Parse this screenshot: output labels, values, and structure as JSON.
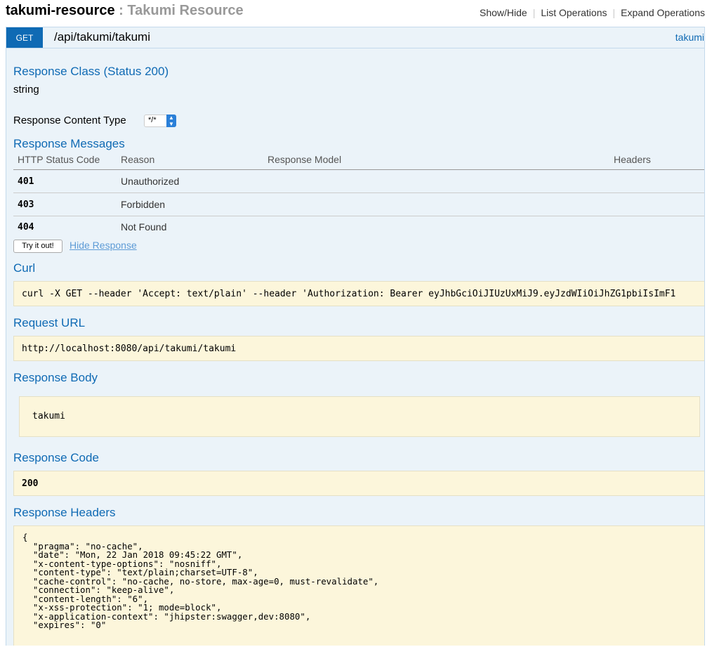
{
  "resource": {
    "name": "takumi-resource",
    "separator": " : ",
    "description": "Takumi Resource"
  },
  "top_links": {
    "show_hide": "Show/Hide",
    "list_operations": "List Operations",
    "expand_operations": "Expand Operations"
  },
  "operation": {
    "method": "GET",
    "path": "/api/takumi/takumi",
    "tag": "takumi"
  },
  "response_class": {
    "heading": "Response Class (Status 200)",
    "type": "string"
  },
  "content_type": {
    "label": "Response Content Type",
    "selected": "*/*"
  },
  "response_messages": {
    "heading": "Response Messages",
    "columns": [
      "HTTP Status Code",
      "Reason",
      "Response Model",
      "Headers"
    ],
    "rows": [
      {
        "code": "401",
        "reason": "Unauthorized",
        "model": "",
        "headers": ""
      },
      {
        "code": "403",
        "reason": "Forbidden",
        "model": "",
        "headers": ""
      },
      {
        "code": "404",
        "reason": "Not Found",
        "model": "",
        "headers": ""
      }
    ]
  },
  "actions": {
    "try_it": "Try it out!",
    "hide_response": "Hide Response"
  },
  "curl": {
    "heading": "Curl",
    "command": "curl -X GET --header 'Accept: text/plain' --header 'Authorization: Bearer eyJhbGciOiJIUzUxMiJ9.eyJzdWIiOiJhZG1pbiIsImF1"
  },
  "request_url": {
    "heading": "Request URL",
    "url": "http://localhost:8080/api/takumi/takumi"
  },
  "response_body": {
    "heading": "Response Body",
    "body": "takumi"
  },
  "response_code": {
    "heading": "Response Code",
    "code": "200"
  },
  "response_headers": {
    "heading": "Response Headers",
    "text": "{\n  \"pragma\": \"no-cache\",\n  \"date\": \"Mon, 22 Jan 2018 09:45:22 GMT\",\n  \"x-content-type-options\": \"nosniff\",\n  \"content-type\": \"text/plain;charset=UTF-8\",\n  \"cache-control\": \"no-cache, no-store, max-age=0, must-revalidate\",\n  \"connection\": \"keep-alive\",\n  \"content-length\": \"6\",\n  \"x-xss-protection\": \"1; mode=block\",\n  \"x-application-context\": \"jhipster:swagger,dev:8080\",\n  \"expires\": \"0\""
  }
}
